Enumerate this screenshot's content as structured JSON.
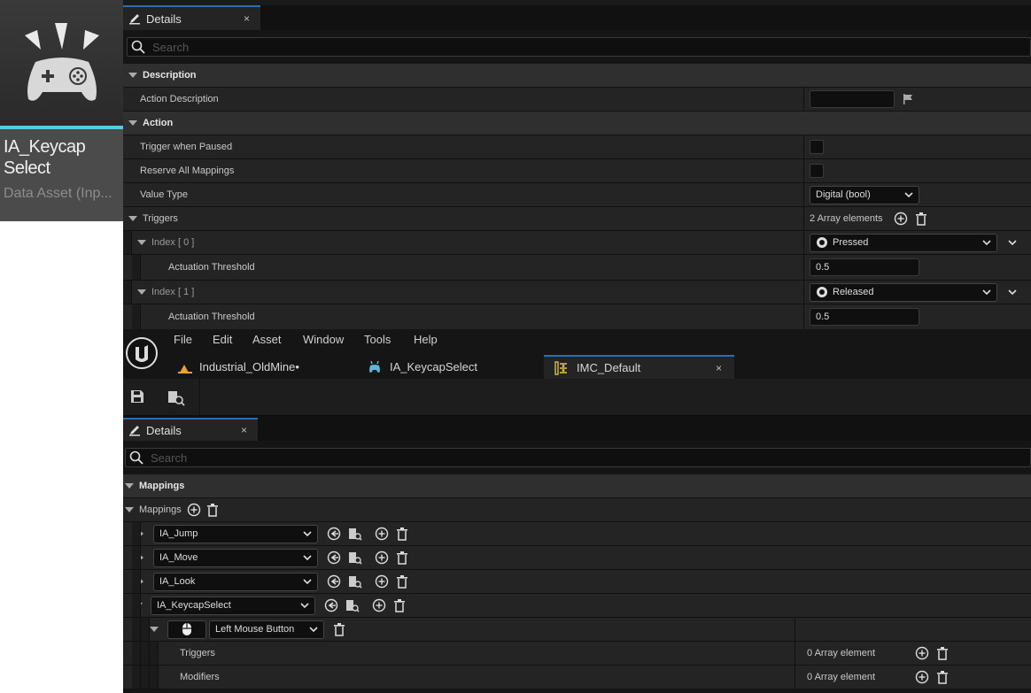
{
  "thumbnail": {
    "asset_name": "IA_Keycap Select",
    "asset_type": "Data Asset (Inp..."
  },
  "top_panel": {
    "tab_label": "Details",
    "tab_close": "×",
    "search_placeholder": "Search",
    "categories": {
      "description": "Description",
      "action": "Action"
    },
    "rows": {
      "action_description": "Action Description",
      "trigger_when_paused": "Trigger when Paused",
      "reserve_all_mappings": "Reserve All Mappings",
      "value_type": "Value Type",
      "value_type_value": "Digital (bool)",
      "triggers": "Triggers",
      "triggers_count": "2 Array elements",
      "index0": "Index [ 0 ]",
      "index0_value": "Pressed",
      "threshold0": "Actuation Threshold",
      "threshold0_value": "0.5",
      "index1": "Index [ 1 ]",
      "index1_value": "Released",
      "threshold1": "Actuation Threshold",
      "threshold1_value": "0.5"
    }
  },
  "editor": {
    "menu": [
      "File",
      "Edit",
      "Asset",
      "Window",
      "Tools",
      "Help"
    ],
    "doc_tabs": [
      "Industrial_OldMine•",
      "IA_KeycapSelect",
      "IMC_Default"
    ],
    "doc_tab_close": "×"
  },
  "bottom_panel": {
    "tab_label": "Details",
    "tab_close": "×",
    "search_placeholder": "Search",
    "category": "Mappings",
    "mappings_label": "Mappings",
    "mappings": [
      "IA_Jump",
      "IA_Move",
      "IA_Look",
      "IA_KeycapSelect"
    ],
    "key_label": "Left Mouse Button",
    "triggers_label": "Triggers",
    "triggers_count": "0 Array element",
    "modifiers_label": "Modifiers",
    "modifiers_count": "0 Array element"
  },
  "colors": {
    "accent_blue": "#2a6fb5",
    "thumbnail_bar": "#56c9e4",
    "panel_bg": "#151515"
  }
}
